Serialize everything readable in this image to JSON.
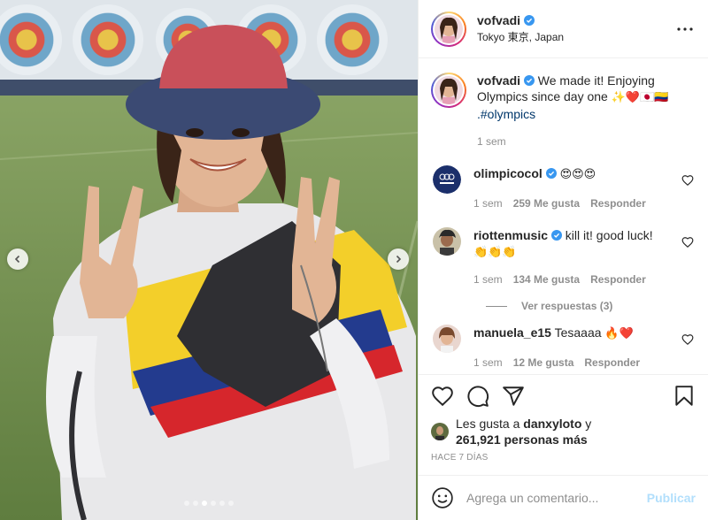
{
  "post": {
    "username": "vofvadi",
    "location": "Tokyo 東京, Japan",
    "caption": {
      "username": "vofvadi",
      "text": "We made it! Enjoying Olympics since day one",
      "emojis": "✨❤️🇯🇵🇨🇴",
      "hashtag": ".#olympics",
      "time": "1 sem"
    },
    "comments": [
      {
        "username": "olimpicocol",
        "verified": true,
        "text": "",
        "emojis": "😍😍😍",
        "time": "1 sem",
        "likes": "259 Me gusta",
        "reply_label": "Responder"
      },
      {
        "username": "riottenmusic",
        "verified": true,
        "text": "kill it! good luck!",
        "emojis": "👏👏👏",
        "time": "1 sem",
        "likes": "134 Me gusta",
        "reply_label": "Responder",
        "view_replies": "Ver respuestas (3)"
      },
      {
        "username": "manuela_e15",
        "verified": false,
        "text": "Tesaaaa",
        "emojis": "🔥❤️",
        "time": "1 sem",
        "likes": "12 Me gusta",
        "reply_label": "Responder"
      }
    ],
    "likes": {
      "prefix": "Les gusta a",
      "user": "danxyloto",
      "connector": "y",
      "others": "261,921 personas más"
    },
    "time_ago": "HACE 7 DÍAS",
    "add_comment": {
      "placeholder": "Agrega un comentario...",
      "publish_label": "Publicar"
    },
    "carousel": {
      "total": 6,
      "active_index": 2
    },
    "icons": {
      "more": "more-options-icon",
      "verified": "verified-badge-icon",
      "like": "heart-icon",
      "comment": "comment-icon",
      "share": "share-icon",
      "save": "bookmark-icon",
      "emoji": "emoji-smile-icon",
      "prev": "chevron-left-icon",
      "next": "chevron-right-icon"
    },
    "colors": {
      "verified": "#3897f0",
      "link": "#00376b",
      "muted": "#8e8e8e",
      "publish_disabled": "#b2dffc"
    }
  }
}
